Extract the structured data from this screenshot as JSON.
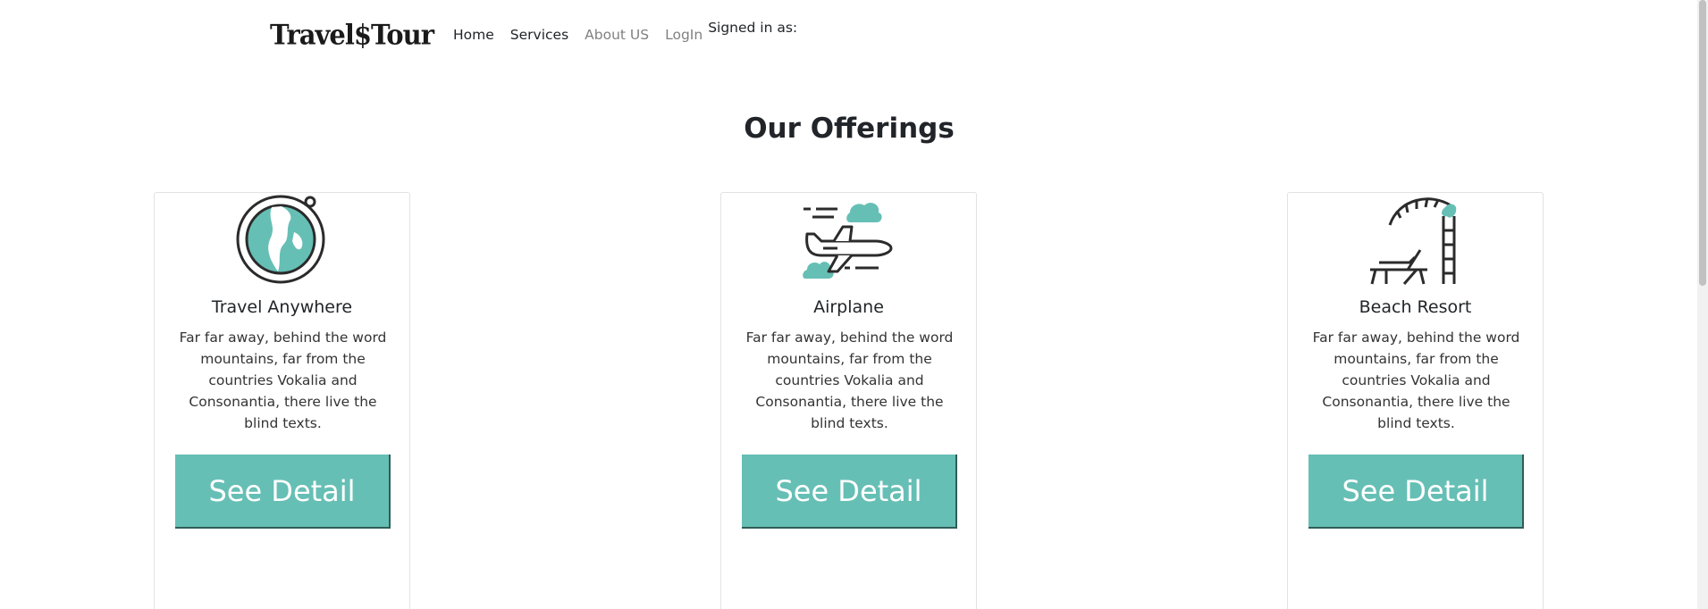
{
  "navbar": {
    "brand": "Travel$Tour",
    "links": [
      "Home",
      "Services",
      "About US",
      "LogIn"
    ],
    "signed_in": "Signed in as:"
  },
  "section": {
    "title": "Our Offerings"
  },
  "cards": [
    {
      "icon": "globe-icon",
      "title": "Travel Anywhere",
      "text": "Far far away, behind the word mountains, far from the countries Vokalia and Consonantia, there live the blind texts.",
      "button": "See Detail"
    },
    {
      "icon": "airplane-icon",
      "title": "Airplane",
      "text": "Far far away, behind the word mountains, far from the countries Vokalia and Consonantia, there live the blind texts.",
      "button": "See Detail"
    },
    {
      "icon": "beach-resort-icon",
      "title": "Beach Resort",
      "text": "Far far away, behind the word mountains, far from the countries Vokalia and Consonantia, there live the blind texts.",
      "button": "See Detail"
    }
  ],
  "colors": {
    "accent": "#66bfb5",
    "icon_stroke": "#2b2b2b"
  }
}
